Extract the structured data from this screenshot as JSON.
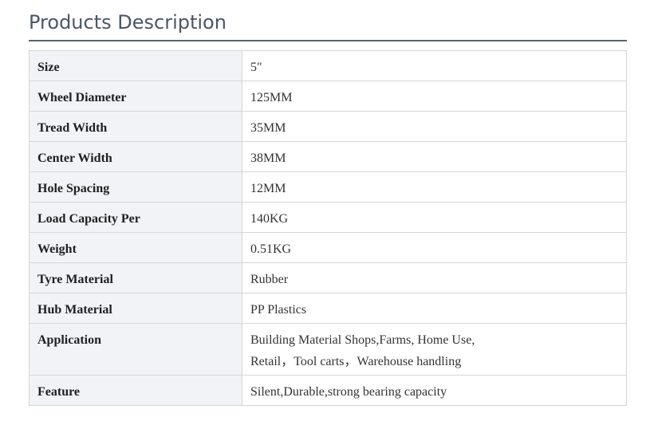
{
  "section": {
    "title": "Products Description"
  },
  "specs": [
    {
      "label": "Size",
      "value": "5\""
    },
    {
      "label": "Wheel Diameter",
      "value": "125MM"
    },
    {
      "label": "Tread Width",
      "value": "35MM"
    },
    {
      "label": "Center Width",
      "value": "38MM"
    },
    {
      "label": "Hole Spacing",
      "value": "12MM"
    },
    {
      "label": "Load Capacity Per",
      "value": "140KG"
    },
    {
      "label": "Weight",
      "value": "0.51KG"
    },
    {
      "label": "Tyre Material",
      "value": "Rubber"
    },
    {
      "label": "Hub Material",
      "value": "PP Plastics"
    },
    {
      "label": "Application",
      "value_line1": "Building Material Shops,Farms, Home Use,",
      "value_line2": "Retail，Tool carts，Warehouse handling"
    },
    {
      "label": "Feature",
      "value": "Silent,Durable,strong bearing capacity"
    }
  ]
}
